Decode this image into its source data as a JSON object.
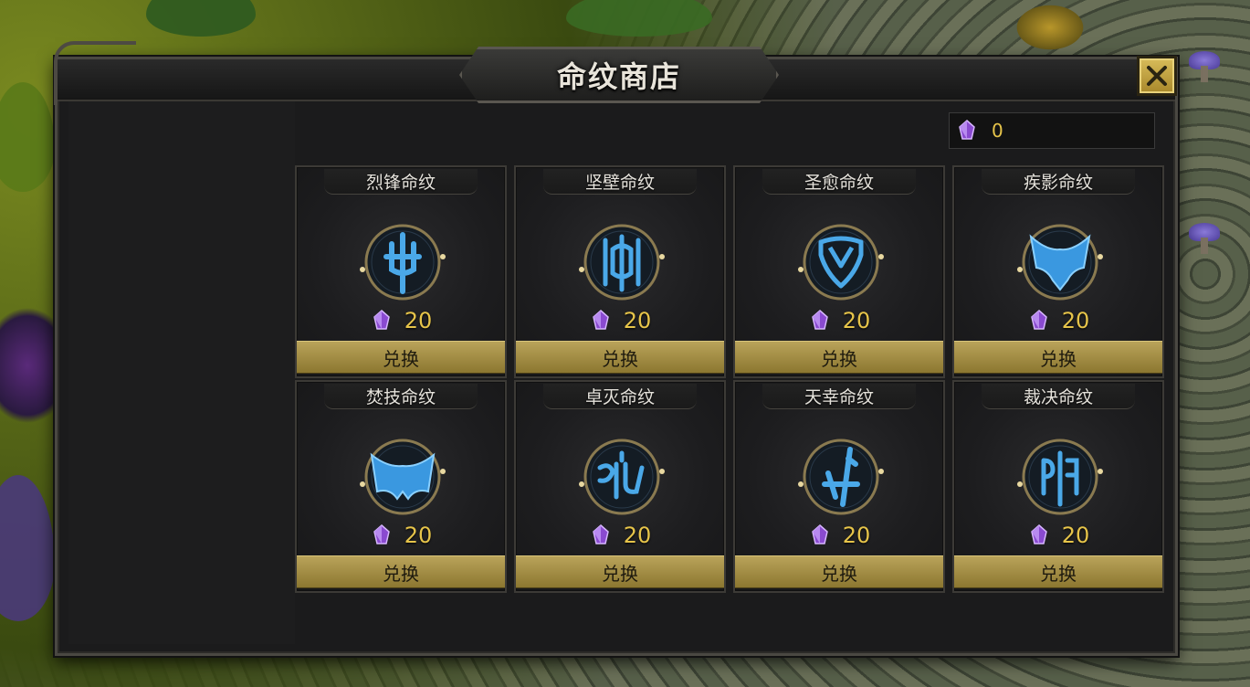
{
  "window": {
    "title": "命纹商店",
    "close_icon": "close-x-icon"
  },
  "currency": {
    "icon": "purple-crystal-icon",
    "value": "0"
  },
  "colors": {
    "gold_text": "#e6c44a",
    "button_gold": "#b9a35a",
    "rune_blue": "#4aa8e8",
    "crystal_purple": "#9a5ad8"
  },
  "cards": [
    {
      "name": "烈锋命纹",
      "price": "20",
      "button": "兑换",
      "icon": "rune-trident-icon"
    },
    {
      "name": "坚壁命纹",
      "price": "20",
      "button": "兑换",
      "icon": "rune-shield-icon"
    },
    {
      "name": "圣愈命纹",
      "price": "20",
      "button": "兑换",
      "icon": "rune-heart-icon"
    },
    {
      "name": "疾影命纹",
      "price": "20",
      "button": "兑换",
      "icon": "rune-wings-icon"
    },
    {
      "name": "焚技命纹",
      "price": "20",
      "button": "兑换",
      "icon": "rune-crown-icon"
    },
    {
      "name": "卓灭命纹",
      "price": "20",
      "button": "兑换",
      "icon": "rune-glyph-icon"
    },
    {
      "name": "天幸命纹",
      "price": "20",
      "button": "兑换",
      "icon": "rune-arrow-icon"
    },
    {
      "name": "裁决命纹",
      "price": "20",
      "button": "兑换",
      "icon": "rune-judge-icon"
    }
  ]
}
